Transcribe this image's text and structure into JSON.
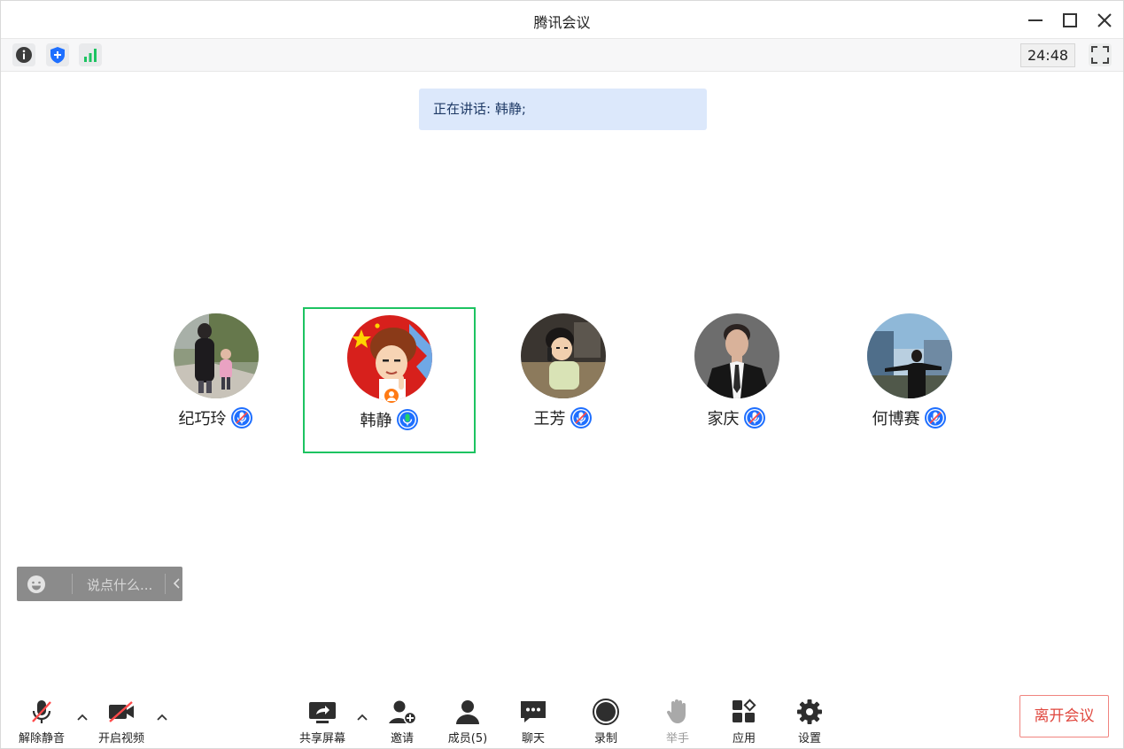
{
  "window": {
    "title": "腾讯会议"
  },
  "infobar": {
    "timer": "24:48"
  },
  "speaking": {
    "text": "正在讲话: 韩静;"
  },
  "participants": [
    {
      "name": "纪巧玲",
      "mic": "muted"
    },
    {
      "name": "韩静",
      "mic": "speaking",
      "active": true,
      "host": true
    },
    {
      "name": "王芳",
      "mic": "muted"
    },
    {
      "name": "家庆",
      "mic": "muted"
    },
    {
      "name": "何博赛",
      "mic": "muted"
    }
  ],
  "chat": {
    "placeholder": "说点什么..."
  },
  "toolbar": {
    "unmute": "解除静音",
    "video": "开启视频",
    "share": "共享屏幕",
    "invite": "邀请",
    "members": "成员(5)",
    "chat": "聊天",
    "record": "录制",
    "raise_hand": "举手",
    "apps": "应用",
    "settings": "设置",
    "leave": "离开会议"
  },
  "colors": {
    "active_border": "#1dc361",
    "speaking_bg": "#dce8fb",
    "mic_blue": "#1e6fff",
    "leave_red": "#e0483f"
  }
}
